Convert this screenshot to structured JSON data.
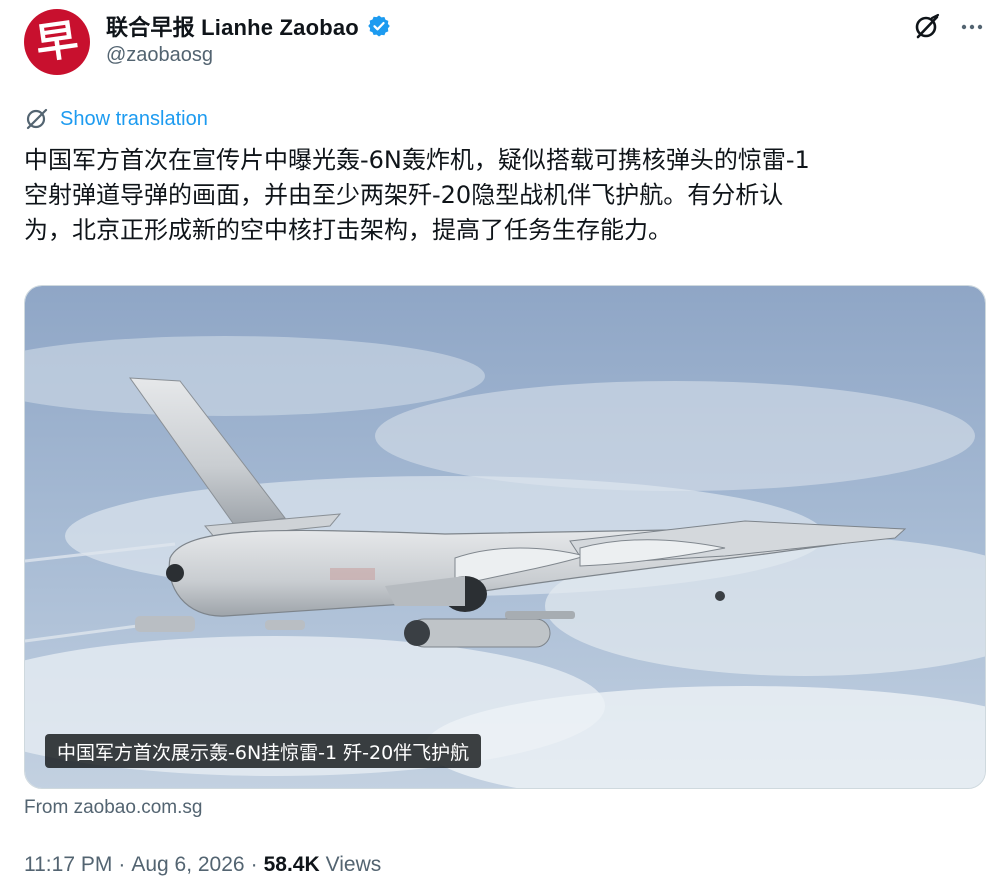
{
  "account": {
    "display_name": "联合早报 Lianhe Zaobao",
    "handle": "@zaobaosg",
    "avatar_glyph": "早",
    "avatar_color": "#c8102e",
    "verified": true,
    "verified_color": "#1d9bf0"
  },
  "actions": {
    "grok_icon": "grok-icon",
    "more_icon": "more-icon"
  },
  "translation": {
    "label": "Show translation",
    "icon": "globe-icon"
  },
  "tweet": {
    "text": "中国军方首次在宣传片中曝光轰-6N轰炸机，疑似搭载可携核弹头的惊雷-1\n空射弹道导弹的画面，并由至少两架歼-20隐型战机伴飞护航。有分析认\n为，北京正形成新的空中核打击架构，提高了任务生存能力。"
  },
  "media": {
    "caption": "中国军方首次展示轰-6N挂惊雷-1 歼-20伴飞护航",
    "image_desc_icon": "bomber-aircraft-photo"
  },
  "card": {
    "source": "From zaobao.com.sg"
  },
  "meta": {
    "time": "11:17 PM",
    "sep1": "·",
    "date": "Aug 6, 2026",
    "sep2": "·",
    "views_count": "58.4K",
    "views_label": "Views"
  },
  "colors": {
    "link": "#1d9bf0",
    "secondary": "#536471",
    "text": "#0f1419"
  }
}
